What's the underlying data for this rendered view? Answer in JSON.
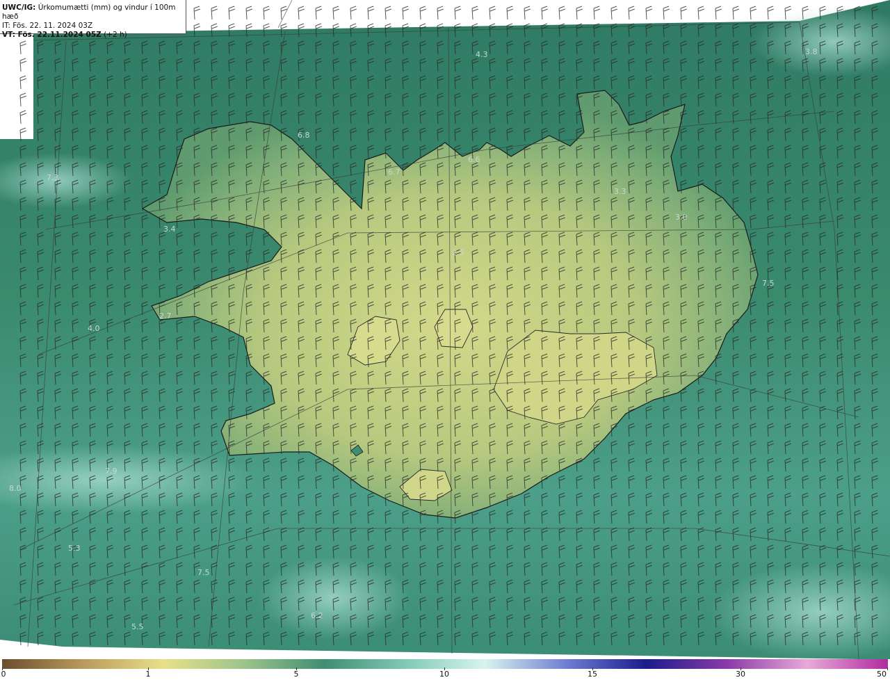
{
  "header": {
    "line1_bold": "UWC/IG:",
    "line1_text": " Úrkomumætti (mm) og vindur í 100m hæð",
    "line2_text": "IT: Fös. 22. 11. 2024 03Z",
    "line3_bold": "VT: Fös. 22.11.2024 05Z",
    "line3_text": " (+2 h)"
  },
  "colors": {
    "ocean_dark": "#2f7a63",
    "ocean_mid": "#3f8e72",
    "ocean_light": "#6fb8a4",
    "land_low": "#5f9b6e",
    "land_high": "#cfd787",
    "coastline": "#1a1a1a",
    "barb": "#2b2b2b",
    "gridline": "#3a3a3a"
  },
  "map_labels": [
    {
      "text": "4.3"
    },
    {
      "text": "3.8"
    },
    {
      "text": "6.8"
    },
    {
      "text": "7.3"
    },
    {
      "text": "6.7"
    },
    {
      "text": "6.6"
    },
    {
      "text": "3.3"
    },
    {
      "text": "3.0"
    },
    {
      "text": "3.4"
    },
    {
      "text": "2.5"
    },
    {
      "text": "7.5"
    },
    {
      "text": "2.7"
    },
    {
      "text": "4.0"
    },
    {
      "text": "7.9"
    },
    {
      "text": "8.0"
    },
    {
      "text": "5.3"
    },
    {
      "text": "7.5"
    },
    {
      "text": "6.2"
    },
    {
      "text": "5.5"
    }
  ],
  "colorbar": {
    "ticks": [
      "0",
      "1",
      "5",
      "10",
      "15",
      "30",
      "50"
    ],
    "stops": [
      "#6b4e2e",
      "#b89a5c",
      "#e8e08a",
      "#9dc48c",
      "#3f8e72",
      "#7fc9b6",
      "#d8f4ef",
      "#6f7fd4",
      "#1c1c8a",
      "#8a3aa8",
      "#e8a9d8",
      "#b02aa0"
    ]
  }
}
